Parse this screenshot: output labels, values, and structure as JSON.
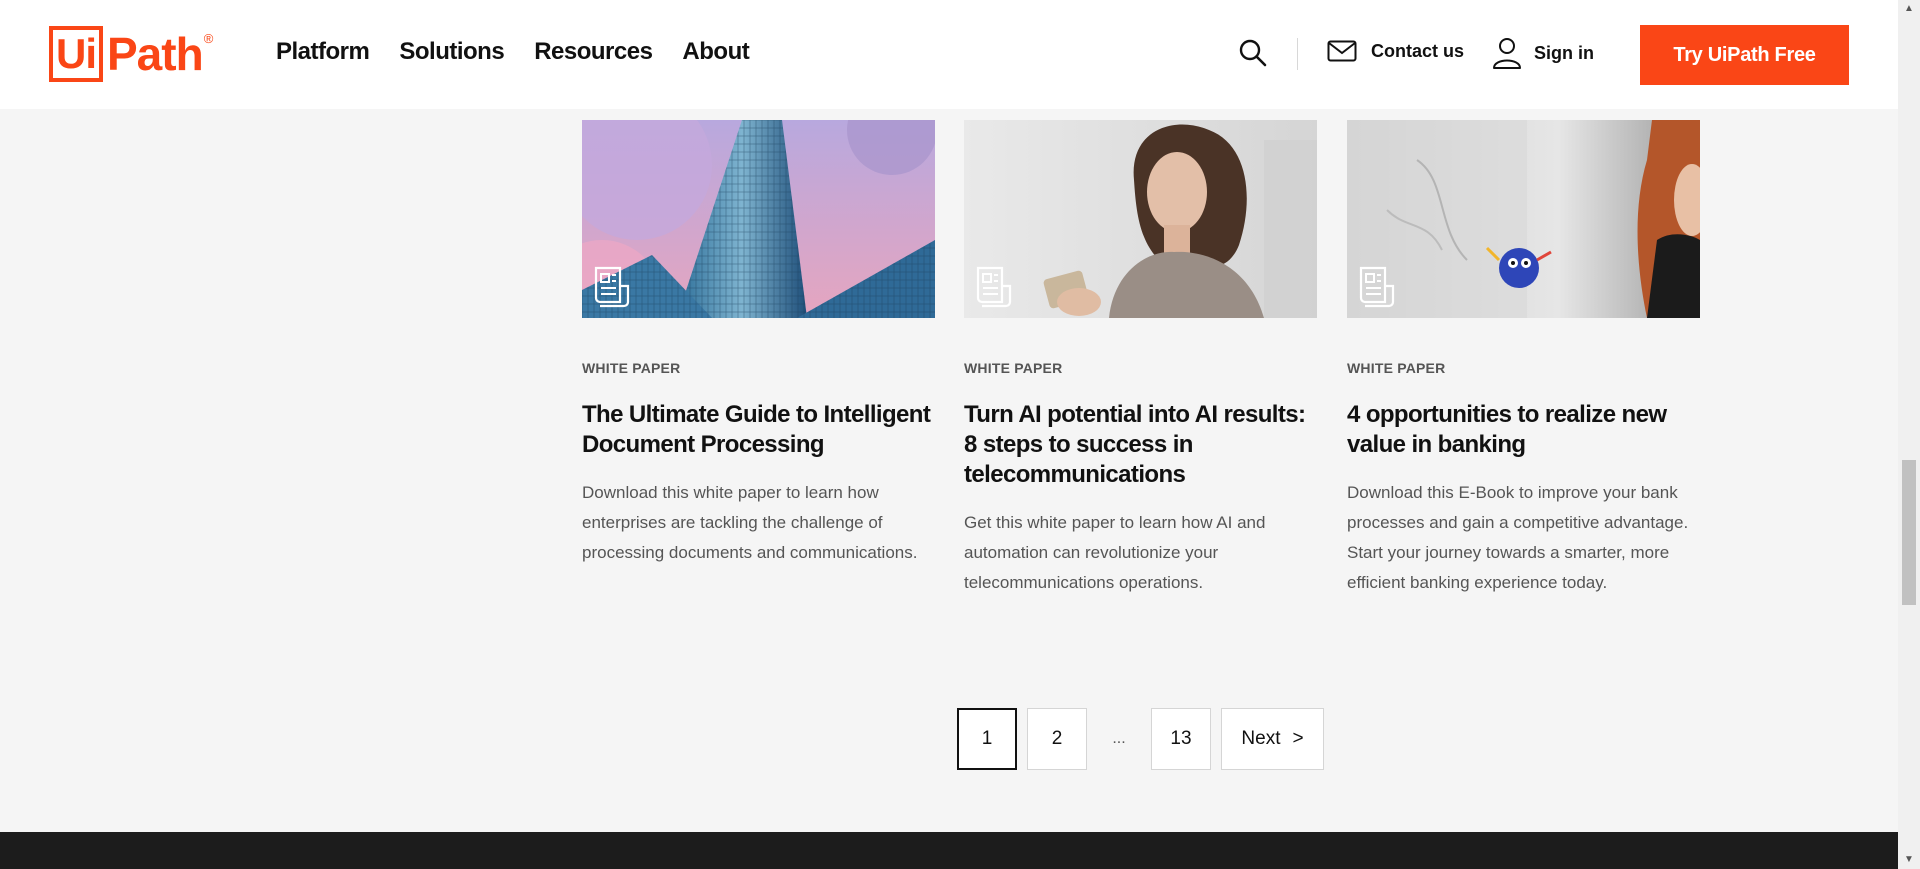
{
  "header": {
    "logo_text": "UiPath",
    "nav": [
      "Platform",
      "Solutions",
      "Resources",
      "About"
    ],
    "contact_label": "Contact us",
    "signin_label": "Sign in",
    "cta_label": "Try UiPath Free"
  },
  "cards": [
    {
      "tag": "WHITE PAPER",
      "title": "The Ultimate Guide to Intelligent Document Processing",
      "description": "Download this white paper to learn how enterprises are tackling the challenge of processing documents and communications.",
      "image": "skyscraper-photo"
    },
    {
      "tag": "WHITE PAPER",
      "title": "Turn AI potential into AI results: 8 steps to success in telecommunications",
      "description": "Get this white paper to learn how AI and automation can revolutionize your telecommunications operations.",
      "image": "woman-with-phone-photo"
    },
    {
      "tag": "WHITE PAPER",
      "title": "4 opportunities to realize new value in banking",
      "description": "Download this E-Book to improve your bank processes and gain a competitive advantage. Start your journey towards a smarter, more efficient banking experience today.",
      "image": "whiteboard-robot-photo"
    }
  ],
  "pagination": {
    "pages": [
      "1",
      "2"
    ],
    "ellipsis": "...",
    "last": "13",
    "next_label": "Next",
    "next_arrow": ">",
    "current": 1
  },
  "colors": {
    "brand": "#fa4616",
    "page_bg": "#f5f5f5",
    "footer": "#1c1c1c"
  },
  "icons": [
    "search-icon",
    "mail-icon",
    "user-icon",
    "document-icon"
  ]
}
